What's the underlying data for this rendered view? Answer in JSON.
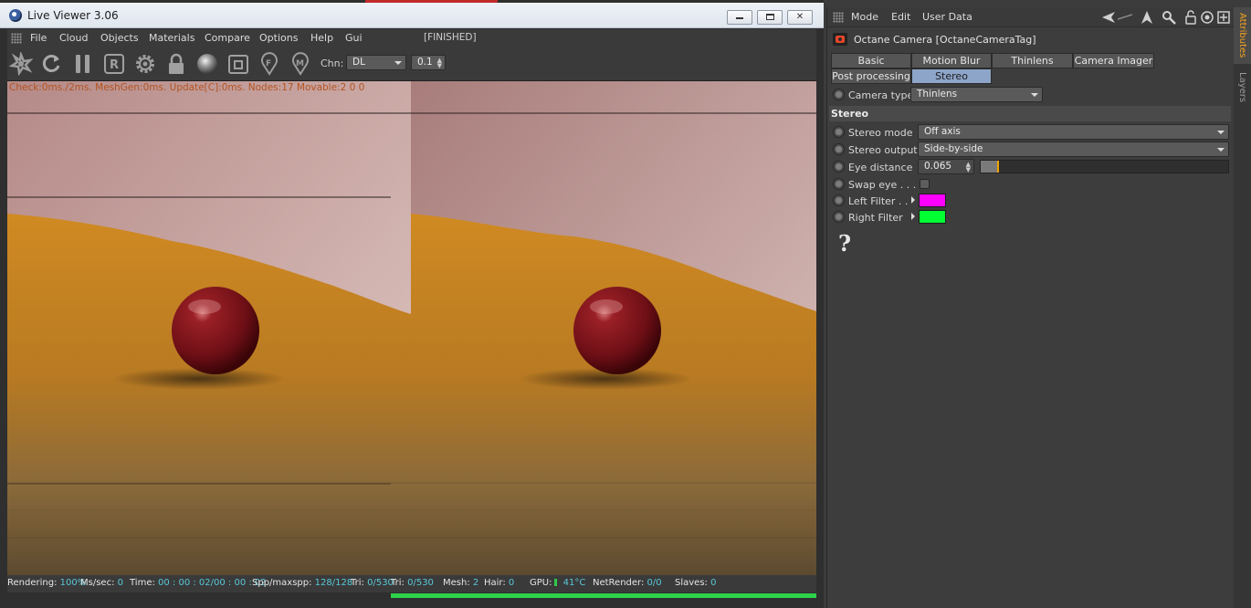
{
  "live_viewer": {
    "title": "Live Viewer 3.06",
    "menu": [
      "File",
      "Cloud",
      "Objects",
      "Materials",
      "Compare",
      "Options",
      "Help",
      "Gui"
    ],
    "render_state": "[FINISHED]",
    "toolbar_icons": [
      "octane-logo-icon",
      "restart-render-icon",
      "pause-icon",
      "region-render-icon",
      "settings-gear-icon",
      "lock-icon",
      "material-sphere-icon",
      "clay-mode-icon",
      "focus-picker-icon",
      "material-picker-icon"
    ],
    "channel_label": "Chn:",
    "channel_value": "DL",
    "spinner_value": "0.1",
    "render_stats": "Check:0ms./2ms. MeshGen:0ms. Update[C]:0ms. Nodes:17 Movable:2  0 0",
    "status": {
      "rendering_label": "Rendering:",
      "rendering_value": "100%",
      "mssec_label": "Ms/sec:",
      "mssec_value": "0",
      "time_label": "Time:",
      "time_value": "00 : 00 : 02/00 : 00 : 02",
      "spp_label": "Spp/maxspp:",
      "spp_value": "128/128",
      "tri_label": "Tri:",
      "tri_value": "0/530",
      "mesh_label": "Mesh:",
      "mesh_value": "2",
      "hair_label": "Hair:",
      "hair_value": "0",
      "gpu_label": "GPU:",
      "gpu_temp": "41°C",
      "netrender_label": "NetRender:",
      "netrender_value": "0/0",
      "slaves_label": "Slaves:",
      "slaves_value": "0"
    },
    "progress": 1.0
  },
  "attributes": {
    "menu": [
      "Mode",
      "Edit",
      "User Data"
    ],
    "nav_icons": [
      "arrow-back-icon",
      "arrow-up-icon",
      "search-icon",
      "lock-icon",
      "target-icon",
      "new-panel-icon"
    ],
    "object_name": "Octane Camera [OctaneCameraTag]",
    "tabs_row1": [
      "Basic",
      "Motion Blur",
      "Thinlens",
      "Camera Imager"
    ],
    "tabs_row2": [
      "Post processing",
      "Stereo"
    ],
    "active_tab": "Stereo",
    "camera_type_label": "Camera type",
    "camera_type_value": "Thinlens",
    "section_title": "Stereo",
    "stereo_mode_label": "Stereo mode",
    "stereo_mode_value": "Off axis",
    "stereo_output_label": "Stereo output",
    "stereo_output_value": "Side-by-side",
    "eye_distance_label": "Eye distance",
    "eye_distance_value": "0.065",
    "eye_distance_slider": 0.065,
    "swap_eye_label": "Swap eye . . . .",
    "swap_eye_checked": false,
    "left_filter_label": "Left Filter . .",
    "left_filter_color": "#ff00ff",
    "right_filter_label": "Right Filter",
    "right_filter_color": "#00ff33",
    "help_glyph": "?"
  },
  "side_tabs": [
    "Attributes",
    "Layers"
  ]
}
